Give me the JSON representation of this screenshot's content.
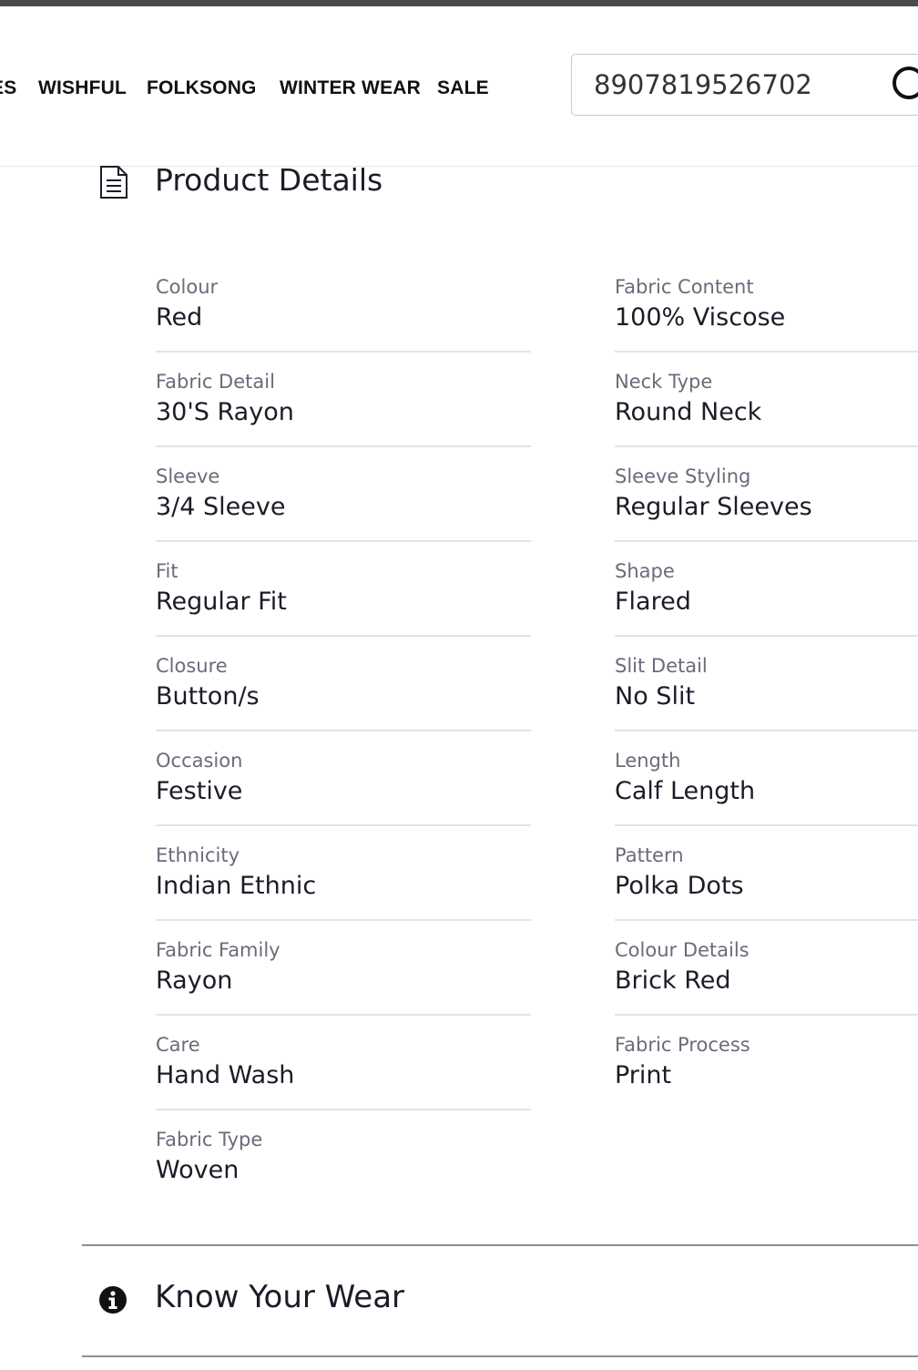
{
  "nav": {
    "items": [
      "ES",
      "WISHFUL",
      "FOLKSONG",
      "WINTER WEAR",
      "SALE"
    ]
  },
  "search": {
    "value": "8907819526702",
    "icon": "search-icon"
  },
  "product_details": {
    "title": "Product Details",
    "icon": "document-icon",
    "left": [
      {
        "label": "Colour",
        "value": "Red"
      },
      {
        "label": "Fabric Detail",
        "value": "30'S Rayon"
      },
      {
        "label": "Sleeve",
        "value": "3/4 Sleeve"
      },
      {
        "label": "Fit",
        "value": "Regular Fit"
      },
      {
        "label": "Closure",
        "value": "Button/s"
      },
      {
        "label": "Occasion",
        "value": "Festive"
      },
      {
        "label": "Ethnicity",
        "value": "Indian Ethnic"
      },
      {
        "label": "Fabric Family",
        "value": "Rayon"
      },
      {
        "label": "Care",
        "value": "Hand Wash"
      },
      {
        "label": "Fabric Type",
        "value": "Woven"
      }
    ],
    "right": [
      {
        "label": "Fabric Content",
        "value": "100% Viscose"
      },
      {
        "label": "Neck Type",
        "value": "Round Neck"
      },
      {
        "label": "Sleeve Styling",
        "value": "Regular Sleeves"
      },
      {
        "label": "Shape",
        "value": "Flared"
      },
      {
        "label": "Slit Detail",
        "value": "No Slit"
      },
      {
        "label": "Length",
        "value": "Calf Length"
      },
      {
        "label": "Pattern",
        "value": "Polka Dots"
      },
      {
        "label": "Colour Details",
        "value": "Brick Red"
      },
      {
        "label": "Fabric Process",
        "value": "Print"
      }
    ]
  },
  "know_your_wear": {
    "title": "Know Your Wear",
    "icon": "info-icon"
  }
}
